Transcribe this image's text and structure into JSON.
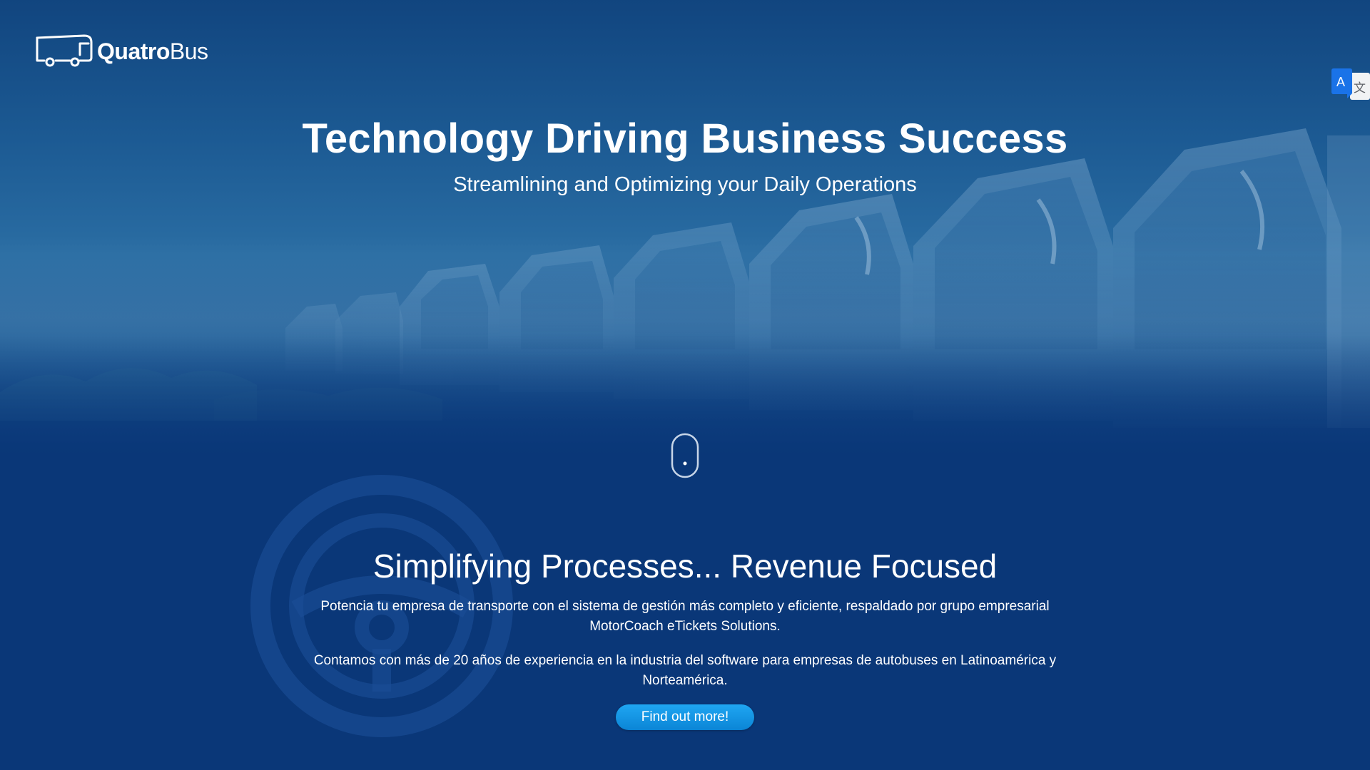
{
  "brand": {
    "name_bold": "Quatro",
    "name_light": "Bus"
  },
  "hero": {
    "title": "Technology Driving Business Success",
    "subtitle": "Streamlining and Optimizing your Daily Operations"
  },
  "section": {
    "title": "Simplifying Processes... Revenue Focused",
    "paragraph_1": "Potencia tu empresa de transporte con el sistema de gestión más completo y eficiente, respaldado por grupo empresarial MotorCoach eTickets Solutions.",
    "paragraph_2": "Contamos con más de 20 años de experiencia en la industria del software para empresas de autobuses en Latinoamérica y Norteamérica.",
    "cta_label": "Find out more!"
  },
  "translate_widget": {
    "glyph_latin": "A",
    "glyph_cjk": "文"
  },
  "icons": {
    "logo": "bus-icon",
    "scroll": "mouse-scroll-icon",
    "watermark": "steering-wheel-icon",
    "translate": "translate-icon"
  },
  "colors": {
    "background": "#0a3778",
    "button": "#1598e6",
    "translate_badge": "#1a73e8",
    "text": "#ffffff"
  }
}
